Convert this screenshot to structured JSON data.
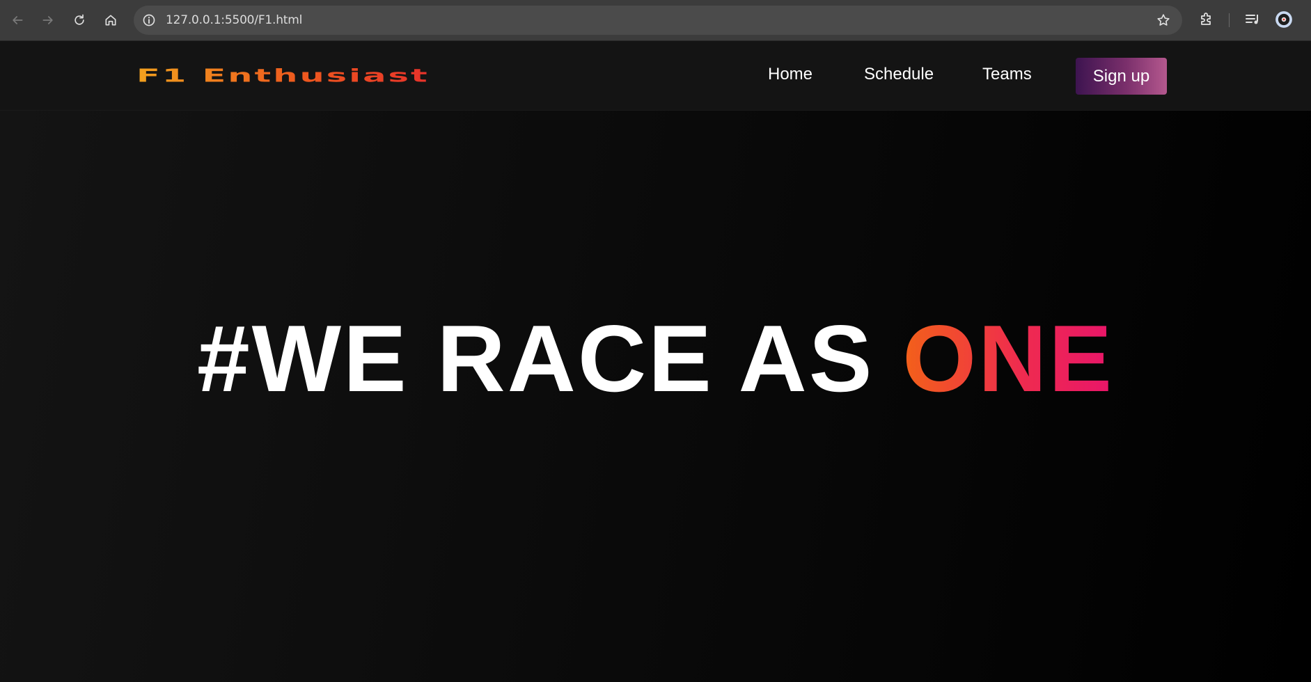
{
  "browser": {
    "url": "127.0.0.1:5500/F1.html",
    "icons": {
      "back": "arrow-left-icon",
      "forward": "arrow-right-icon",
      "reload": "reload-icon",
      "home": "home-icon",
      "site_info": "info-icon",
      "bookmark": "star-icon",
      "extensions": "puzzle-icon",
      "media": "media-queue-icon",
      "profile": "profile-icon"
    }
  },
  "header": {
    "logo": "F1 Enthusiast",
    "nav": [
      {
        "label": "Home"
      },
      {
        "label": "Schedule"
      },
      {
        "label": "Teams"
      }
    ],
    "cta_label": "Sign up"
  },
  "hero": {
    "title_main": "#WE RACE AS ",
    "title_accent": "ONE"
  },
  "colors": {
    "logo_gradient": [
      "#f2a11e",
      "#e8322a"
    ],
    "accent_gradient": [
      "#f36119",
      "#e8156a"
    ],
    "cta_gradient": [
      "#3d1450",
      "#b4588e"
    ],
    "header_bg": "#141414",
    "hero_bg": "#000000"
  }
}
